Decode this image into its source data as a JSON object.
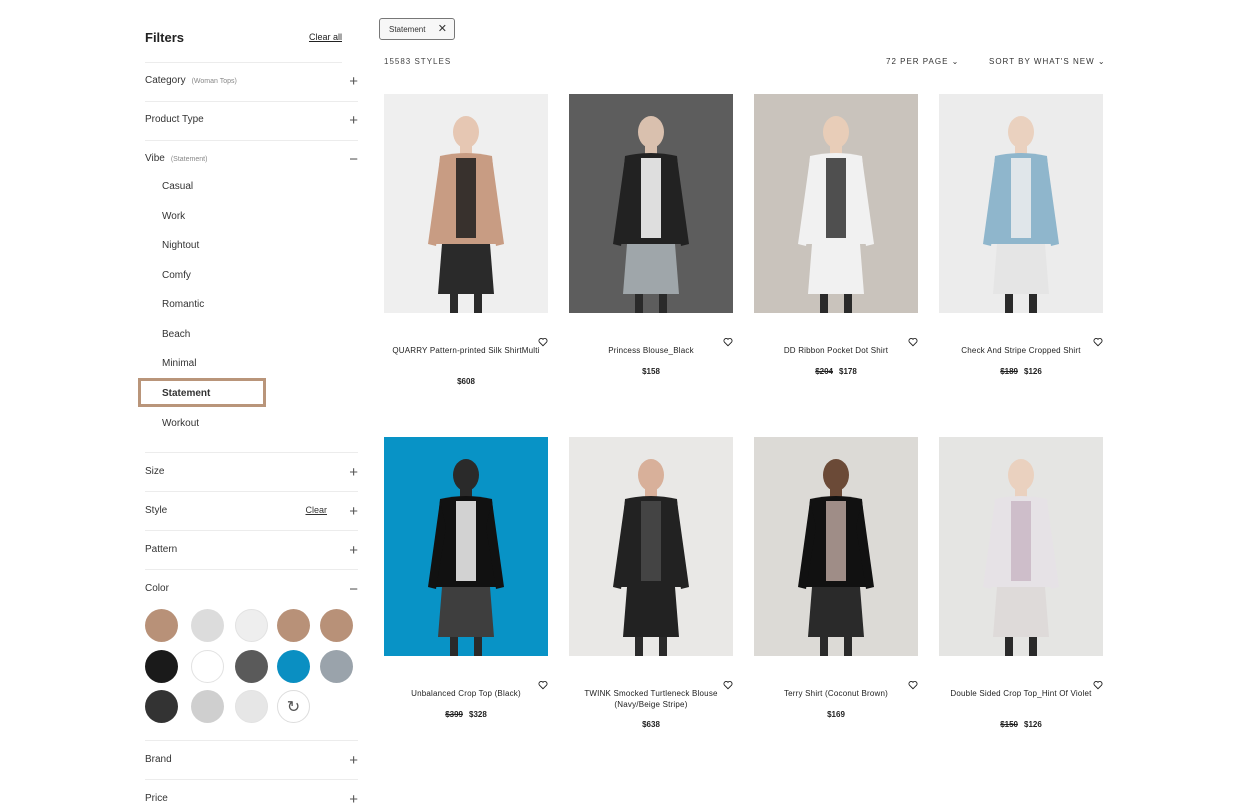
{
  "filters": {
    "title": "Filters",
    "clear_all": "Clear all",
    "category": {
      "label": "Category",
      "sub": "(Woman Tops)"
    },
    "product_type": {
      "label": "Product Type"
    },
    "vibe": {
      "label": "Vibe",
      "sub": "(Statement)",
      "options": [
        "Casual",
        "Work",
        "Nightout",
        "Comfy",
        "Romantic",
        "Beach",
        "Minimal",
        "Statement",
        "Workout"
      ],
      "selected": "Statement"
    },
    "size": {
      "label": "Size"
    },
    "style": {
      "label": "Style",
      "clear": "Clear"
    },
    "pattern": {
      "label": "Pattern"
    },
    "color": {
      "label": "Color",
      "swatches": [
        "#b89178",
        "#dcdcdc",
        "#eeeeee",
        "#b89178",
        "#b89178",
        "#1a1a1a",
        "#ffffff",
        "#5a5a5a",
        "#0a8fc2",
        "#9aa3ab",
        "#333333",
        "#cfcfcf",
        "#e6e6e6"
      ],
      "reset_icon": "refresh-icon"
    },
    "brand": {
      "label": "Brand"
    },
    "price": {
      "label": "Price"
    }
  },
  "active_filter": {
    "label": "Statement",
    "remove_icon": "close-icon"
  },
  "results": {
    "count": "15583 STYLES",
    "per_page": "72 PER PAGE",
    "sort": "SORT BY WHAT'S NEW"
  },
  "products": [
    {
      "name": "QUARRY Pattern-printed Silk ShirtMulti",
      "price": "$608",
      "old_price": ""
    },
    {
      "name": "Princess Blouse_Black",
      "price": "$158",
      "old_price": ""
    },
    {
      "name": "DD Ribbon Pocket Dot Shirt",
      "price": "$178",
      "old_price": "$204"
    },
    {
      "name": "Check And Stripe Cropped Shirt",
      "price": "$126",
      "old_price": "$189"
    },
    {
      "name": "Unbalanced Crop Top (Black)",
      "price": "$328",
      "old_price": "$399"
    },
    {
      "name": "TWINK Smocked Turtleneck Blouse (Navy/Beige Stripe)",
      "price": "$638",
      "old_price": ""
    },
    {
      "name": "Terry Shirt (Coconut Brown)",
      "price": "$169",
      "old_price": ""
    },
    {
      "name": "Double Sided Crop Top_Hint Of Violet",
      "price": "$126",
      "old_price": "$150"
    }
  ]
}
